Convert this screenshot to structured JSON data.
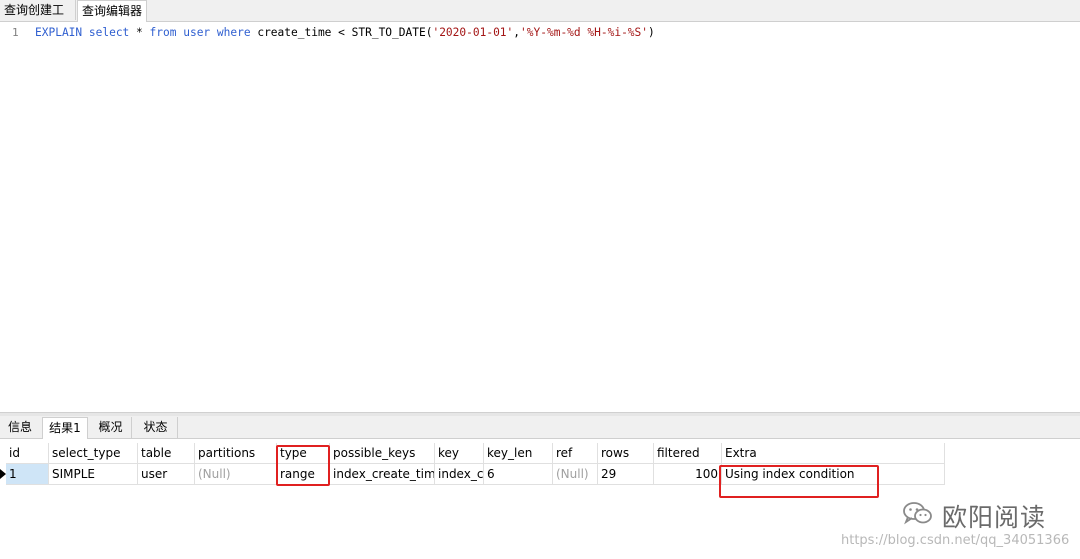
{
  "top_tabs": [
    "查询创建工具",
    "查询编辑器"
  ],
  "editor": {
    "line_number": "1",
    "code_parts": [
      {
        "t": "EXPLAIN select ",
        "c": "kw"
      },
      {
        "t": "* ",
        "c": ""
      },
      {
        "t": "from ",
        "c": "kw"
      },
      {
        "t": "user ",
        "c": "kw"
      },
      {
        "t": "where ",
        "c": "kw"
      },
      {
        "t": "create_time < STR_TO_DATE(",
        "c": ""
      },
      {
        "t": "'2020-01-01'",
        "c": "str"
      },
      {
        "t": ",",
        "c": ""
      },
      {
        "t": "'%Y-%m-%d %H-%i-%S'",
        "c": "str"
      },
      {
        "t": ")",
        "c": ""
      }
    ]
  },
  "bottom_tabs": [
    "信息",
    "结果1",
    "概况",
    "状态"
  ],
  "result": {
    "columns": [
      "id",
      "select_type",
      "table",
      "partitions",
      "type",
      "possible_keys",
      "key",
      "key_len",
      "ref",
      "rows",
      "filtered",
      "Extra"
    ],
    "row": [
      "1",
      "SIMPLE",
      "user",
      "(Null)",
      "range",
      "index_create_time",
      "index_cr",
      "6",
      "(Null)",
      "29",
      "100",
      "Using index condition"
    ]
  },
  "watermark": {
    "name": "欧阳阅读",
    "url": "https://blog.csdn.net/qq_34051366"
  }
}
